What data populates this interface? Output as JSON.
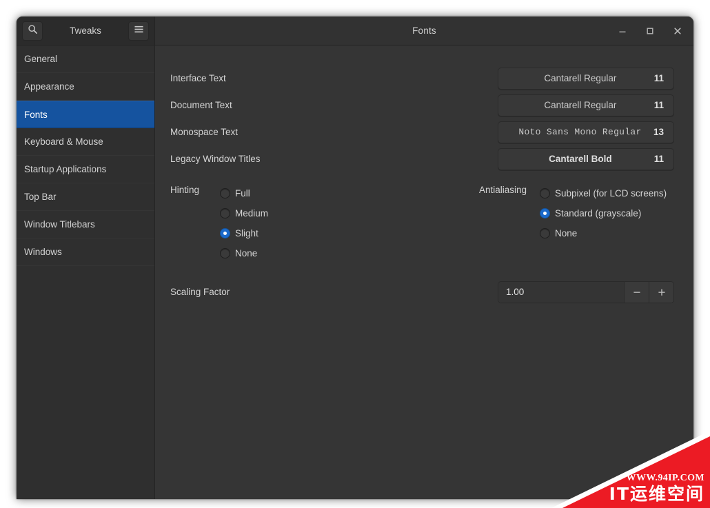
{
  "window": {
    "title": "Fonts",
    "app_name": "Tweaks",
    "search_icon": "search-icon",
    "menu_icon": "hamburger-menu-icon",
    "controls": {
      "minimize": "–",
      "maximize": "□",
      "close": "✕"
    }
  },
  "sidebar": {
    "items": [
      {
        "label": "General",
        "active": false
      },
      {
        "label": "Appearance",
        "active": false
      },
      {
        "label": "Fonts",
        "active": true
      },
      {
        "label": "Keyboard & Mouse",
        "active": false
      },
      {
        "label": "Startup Applications",
        "active": false
      },
      {
        "label": "Top Bar",
        "active": false
      },
      {
        "label": "Window Titlebars",
        "active": false
      },
      {
        "label": "Windows",
        "active": false
      }
    ]
  },
  "main": {
    "font_rows": [
      {
        "label": "Interface Text",
        "font": "Cantarell Regular",
        "size": "11",
        "style": "regular"
      },
      {
        "label": "Document Text",
        "font": "Cantarell Regular",
        "size": "11",
        "style": "regular"
      },
      {
        "label": "Monospace Text",
        "font": "Noto Sans Mono Regular",
        "size": "13",
        "style": "mono"
      },
      {
        "label": "Legacy Window Titles",
        "font": "Cantarell Bold",
        "size": "11",
        "style": "bold"
      }
    ],
    "hinting": {
      "label": "Hinting",
      "options": [
        {
          "label": "Full",
          "selected": false
        },
        {
          "label": "Medium",
          "selected": false
        },
        {
          "label": "Slight",
          "selected": true
        },
        {
          "label": "None",
          "selected": false
        }
      ]
    },
    "antialiasing": {
      "label": "Antialiasing",
      "options": [
        {
          "label": "Subpixel (for LCD screens)",
          "selected": false
        },
        {
          "label": "Standard (grayscale)",
          "selected": true
        },
        {
          "label": "None",
          "selected": false
        }
      ]
    },
    "scaling_factor": {
      "label": "Scaling Factor",
      "value": "1.00",
      "minus": "−",
      "plus": "+"
    }
  },
  "watermark": {
    "url": "WWW.94IP.COM",
    "brand": "IT运维空间",
    "color": "#ec1b24"
  },
  "colors": {
    "window_bg": "#353535",
    "sidebar_bg": "#2f2f2f",
    "header_bg": "#303030",
    "accent_selected": "#15539f",
    "accent_radio": "#1b6acb"
  }
}
